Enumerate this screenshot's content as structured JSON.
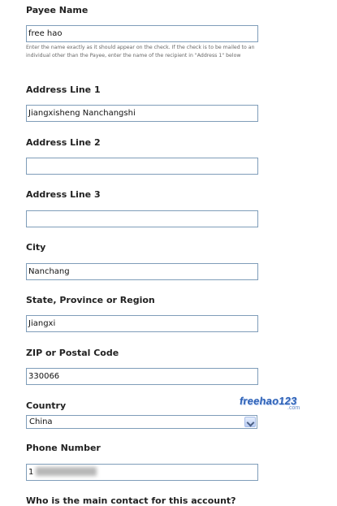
{
  "form": {
    "payee_label": "Payee Name",
    "payee_value": "free hao",
    "payee_help": "Enter the name exactly as it should appear on the check. If the check is to be mailed to an individual other than the Payee, enter the name of the recipient in \"Address 1\" below",
    "address1_label": "Address Line 1",
    "address1_value": "Jiangxisheng Nanchangshi",
    "address2_label": "Address Line 2",
    "address2_value": "",
    "address3_label": "Address Line 3",
    "address3_value": "",
    "city_label": "City",
    "city_value": "Nanchang",
    "state_label": "State, Province or Region",
    "state_value": "Jiangxi",
    "zip_label": "ZIP or Postal Code",
    "zip_value": "330066",
    "country_label": "Country",
    "country_value": "China",
    "phone_label": "Phone Number",
    "phone_value_visible": "1",
    "contact_question": "Who is the main contact for this account?"
  },
  "watermark": {
    "text": "freehao123",
    "sub": ".com"
  }
}
